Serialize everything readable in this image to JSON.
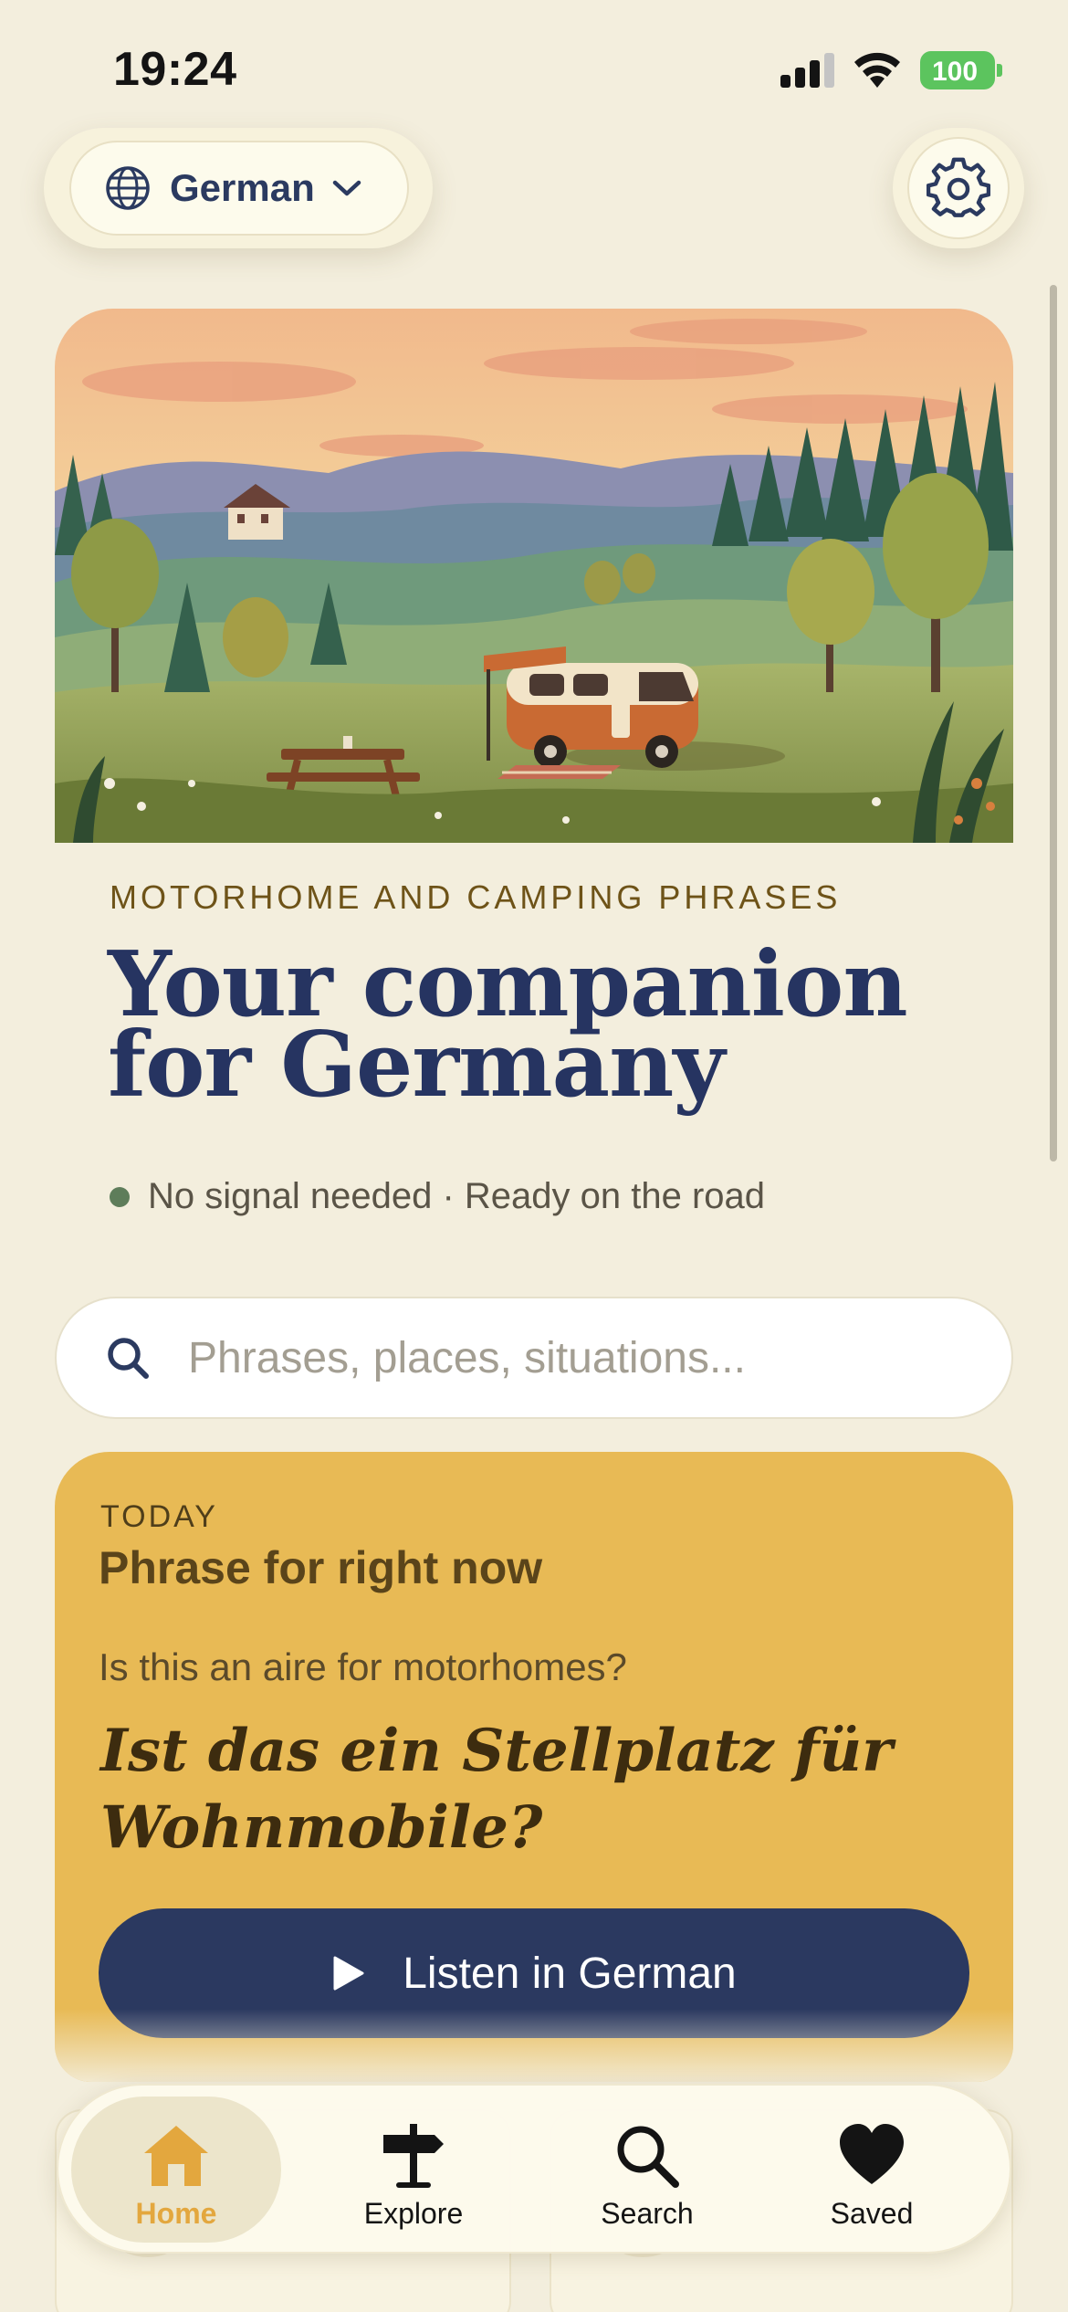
{
  "status_bar": {
    "time": "19:24",
    "battery": "100"
  },
  "language_selector": {
    "label": "German"
  },
  "hero": {
    "eyebrow": "MOTORHOME AND CAMPING PHRASES",
    "headline_line1": "Your companion",
    "headline_line2": "for Germany",
    "tagline": "No signal needed · Ready on the road"
  },
  "search": {
    "placeholder": "Phrases, places, situations..."
  },
  "phrase_card": {
    "eyebrow": "TODAY",
    "title": "Phrase for right now",
    "english": "Is this an aire for motorhomes?",
    "german_line1": "Ist das ein Stellplatz für",
    "german_line2": "Wohnmobile?",
    "listen_label": "Listen in German"
  },
  "tabbar": {
    "items": [
      {
        "label": "Home",
        "icon": "home-icon",
        "active": true
      },
      {
        "label": "Explore",
        "icon": "signpost-icon",
        "active": false
      },
      {
        "label": "Search",
        "icon": "search-icon",
        "active": false
      },
      {
        "label": "Saved",
        "icon": "heart-icon",
        "active": false
      }
    ]
  },
  "colors": {
    "background": "#f3eedd",
    "navy": "#263461",
    "card_gold": "#e8ba55",
    "active_tab": "#e3a73e",
    "status_dot": "#5e7d5a",
    "battery_green": "#5cc45e"
  }
}
